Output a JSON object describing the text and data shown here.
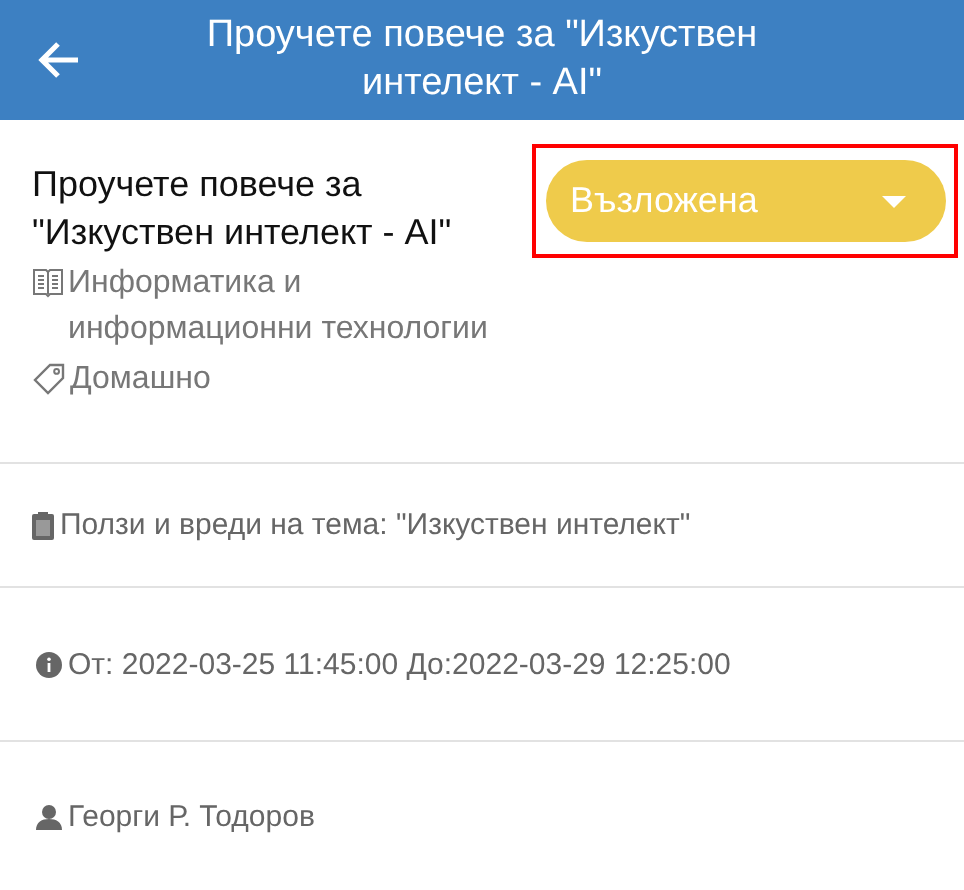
{
  "header": {
    "title": "Проучете повече за \"Изкуствен интелект - AI\""
  },
  "task": {
    "title": "Проучете повече за \"Изкуствен интелект - AI\"",
    "subject": "Информатика и информационни технологии",
    "type": "Домашно",
    "status": {
      "value": "Възложена",
      "highlighted": true
    }
  },
  "details": [
    {
      "kind": "description",
      "text": "Ползи и вреди на тема: \"Изкуствен интелект\""
    },
    {
      "kind": "period",
      "text": "От: 2022-03-25 11:45:00 До:2022-03-29 12:25:00"
    },
    {
      "kind": "author",
      "text": "Георги Р. Тодоров"
    }
  ]
}
